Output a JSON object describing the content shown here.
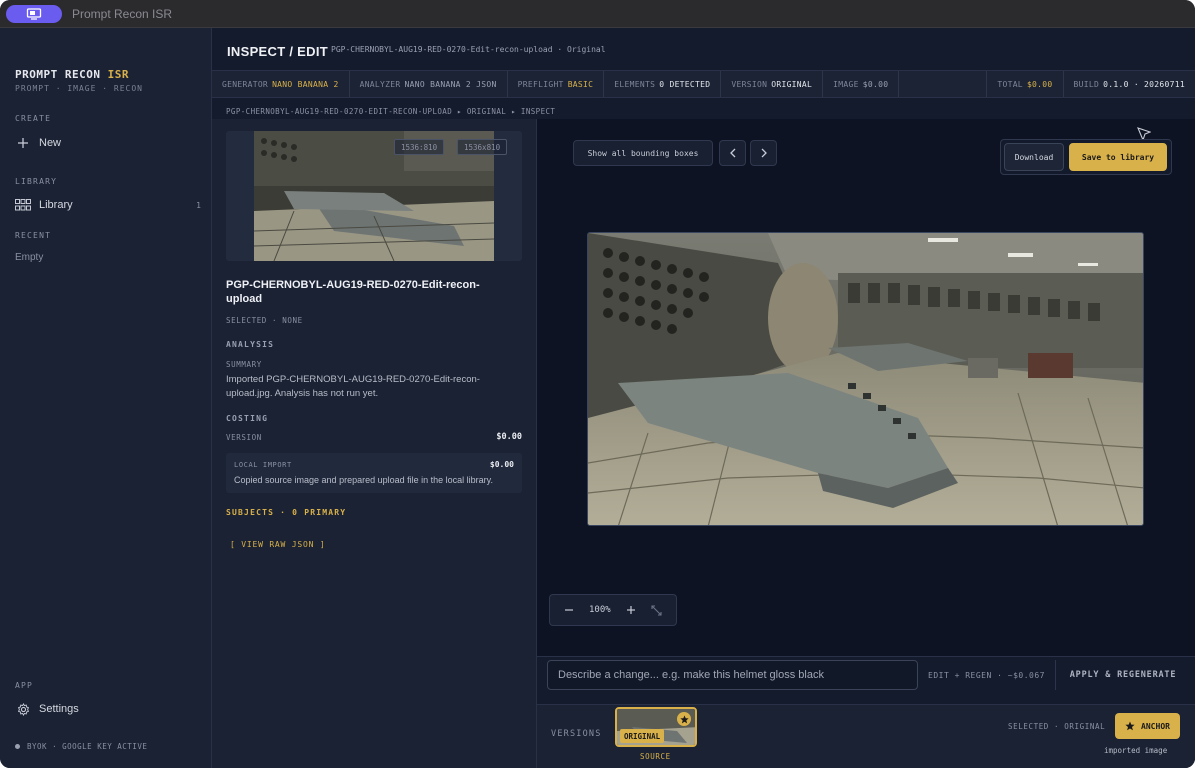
{
  "titlebar": {
    "title": "Prompt Recon ISR",
    "icon": "monitor-icon"
  },
  "brand": {
    "name_main": "PROMPT RECON ",
    "name_accent": "ISR",
    "tagline": "PROMPT · IMAGE · RECON"
  },
  "sidebar": {
    "create_heading": "CREATE",
    "new_label": "New",
    "library_heading": "LIBRARY",
    "library_label": "Library",
    "library_count": "1",
    "recent_heading": "RECENT",
    "recent_empty": "Empty",
    "app_heading": "APP",
    "settings_label": "Settings",
    "byok": "BYOK · GOOGLE KEY ACTIVE"
  },
  "header": {
    "title": "INSPECT / EDIT",
    "subtitle": "PGP-CHERNOBYL-AUG19-RED-0270-Edit-recon-upload · Original"
  },
  "status": {
    "generator_label": "GENERATOR",
    "generator_value": "NANO BANANA 2",
    "analyzer_label": "ANALYZER",
    "analyzer_value": "NANO BANANA 2 JSON",
    "preflight_label": "PREFLIGHT",
    "preflight_value": "BASIC",
    "elements_label": "ELEMENTS",
    "elements_value": "0 DETECTED",
    "version_label": "VERSION",
    "version_value": "ORIGINAL",
    "image_label": "IMAGE",
    "image_value": "$0.00",
    "total_label": "TOTAL",
    "total_value": "$0.00",
    "build_label": "BUILD",
    "build_value": "0.1.0 · 20260711"
  },
  "breadcrumb": "PGP-CHERNOBYL-AUG19-RED-0270-EDIT-RECON-UPLOAD ▸ ORIGINAL ▸ INSPECT",
  "asset": {
    "dim_badge_1": "1536:810",
    "dim_badge_2": "1536x810",
    "title": "PGP-CHERNOBYL-AUG19-RED-0270-Edit-recon-upload",
    "selected": "SELECTED · NONE",
    "analysis_heading": "ANALYSIS",
    "summary_label": "SUMMARY",
    "summary_text": "Imported PGP-CHERNOBYL-AUG19-RED-0270-Edit-recon-upload.jpg. Analysis has not run yet.",
    "costing_heading": "COSTING",
    "version_label": "VERSION",
    "version_cost": "$0.00",
    "local_import_label": "LOCAL IMPORT",
    "local_import_cost": "$0.00",
    "local_import_desc": "Copied source image and prepared upload file in the local library.",
    "subjects": "SUBJECTS · 0 PRIMARY",
    "raw_json": "[ VIEW RAW JSON ]"
  },
  "canvas": {
    "show_boxes": "Show all bounding boxes",
    "download": "Download",
    "save": "Save to library",
    "zoom": "100%"
  },
  "prompt": {
    "placeholder": "Describe a change... e.g. make this helmet gloss black",
    "edit_cost": "EDIT + REGEN · ~$0.067",
    "apply": "APPLY & REGENERATE"
  },
  "versions": {
    "label": "VERSIONS",
    "badge": "ORIGINAL",
    "source": "SOURCE",
    "selected": "SELECTED · ORIGINAL",
    "anchor": "ANCHOR",
    "imported": "imported image"
  },
  "colors": {
    "accent": "#d9b14a",
    "tab": "#6b5cf0",
    "bg": "#141b2c",
    "sidebar": "#1a2233"
  }
}
